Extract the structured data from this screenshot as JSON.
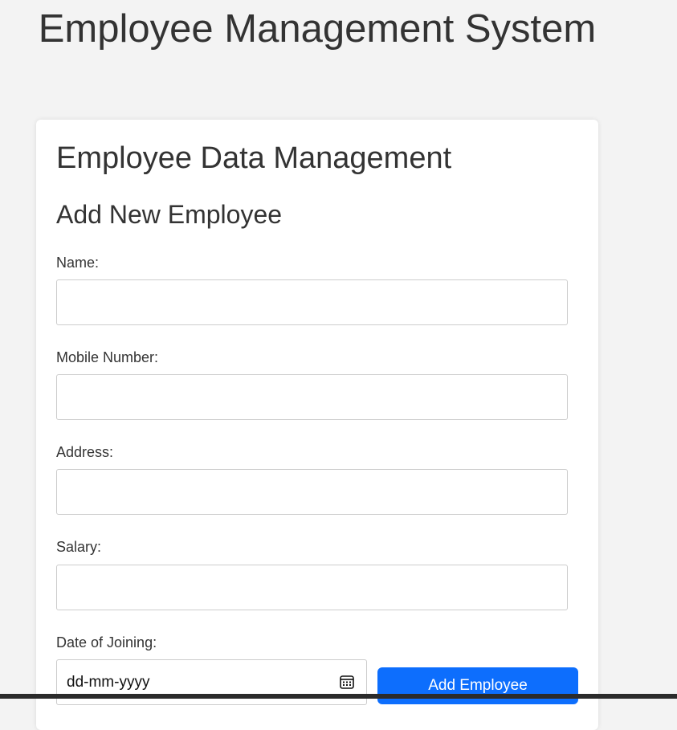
{
  "page": {
    "title": "Employee Management System"
  },
  "card": {
    "title": "Employee Data Management",
    "form_title": "Add New Employee"
  },
  "form": {
    "name": {
      "label": "Name:",
      "value": "",
      "placeholder": ""
    },
    "mobile": {
      "label": "Mobile Number:",
      "value": "",
      "placeholder": ""
    },
    "address": {
      "label": "Address:",
      "value": "",
      "placeholder": ""
    },
    "salary": {
      "label": "Salary:",
      "value": "",
      "placeholder": ""
    },
    "date_of_joining": {
      "label": "Date of Joining:",
      "placeholder": "dd-mm-yyyy",
      "icon": "calendar-icon"
    },
    "submit_label": "Add Employee"
  },
  "colors": {
    "background": "#f3f3f3",
    "card": "#ffffff",
    "text": "#333333",
    "primary_button": "#0d6efd",
    "input_border": "#cccccc"
  }
}
